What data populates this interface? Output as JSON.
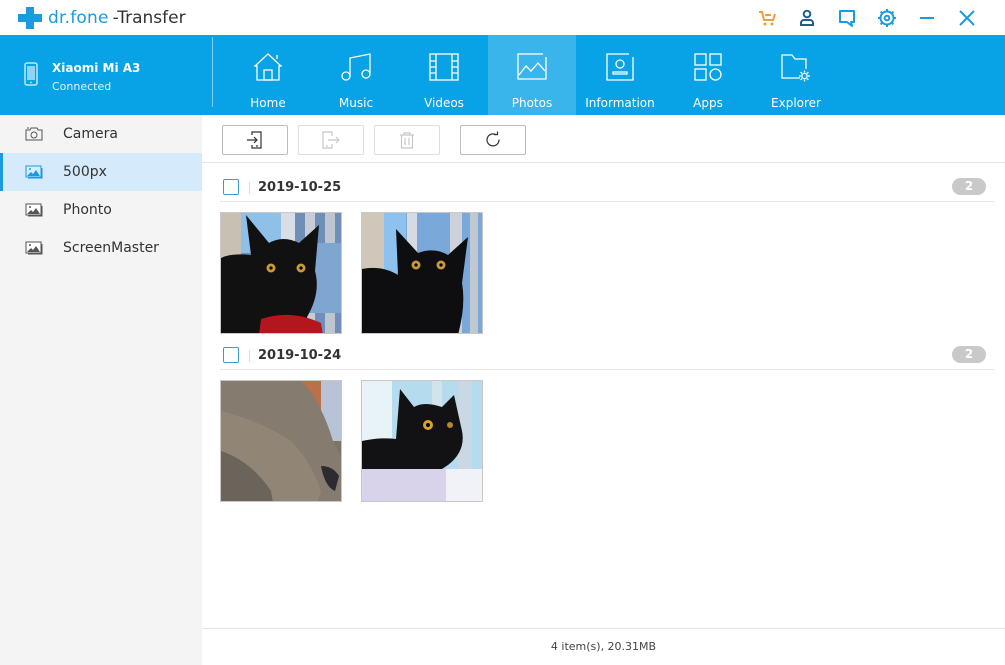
{
  "app": {
    "brand": "dr.fone",
    "product": "-Transfer"
  },
  "window_controls": [
    {
      "name": "cart-icon",
      "color": "#f0a030"
    },
    {
      "name": "user-icon",
      "color": "#1d5f8a"
    },
    {
      "name": "feedback-icon",
      "color": "#1a9be0"
    },
    {
      "name": "settings-icon",
      "color": "#1a9be0"
    },
    {
      "name": "minimize-icon",
      "color": "#1a9be0"
    },
    {
      "name": "close-icon",
      "color": "#1a9be0"
    }
  ],
  "device": {
    "name": "Xiaomi Mi A3",
    "status": "Connected"
  },
  "nav": {
    "active": "Photos",
    "items": [
      {
        "label": "Home",
        "icon": "home-icon"
      },
      {
        "label": "Music",
        "icon": "music-icon"
      },
      {
        "label": "Videos",
        "icon": "videos-icon"
      },
      {
        "label": "Photos",
        "icon": "photos-icon"
      },
      {
        "label": "Information",
        "icon": "information-icon"
      },
      {
        "label": "Apps",
        "icon": "apps-icon"
      },
      {
        "label": "Explorer",
        "icon": "explorer-icon"
      }
    ]
  },
  "sidebar": {
    "active": "500px",
    "items": [
      {
        "label": "Camera",
        "icon": "camera-icon"
      },
      {
        "label": "500px",
        "icon": "album-icon"
      },
      {
        "label": "Phonto",
        "icon": "album-icon"
      },
      {
        "label": "ScreenMaster",
        "icon": "album-icon"
      }
    ]
  },
  "toolbar": {
    "buttons": [
      {
        "name": "import-button",
        "icon": "import-icon",
        "enabled": true
      },
      {
        "name": "export-button",
        "icon": "export-icon",
        "enabled": false
      },
      {
        "name": "delete-button",
        "icon": "trash-icon",
        "enabled": false
      },
      {
        "name": "refresh-button",
        "icon": "refresh-icon",
        "enabled": true
      }
    ]
  },
  "groups": [
    {
      "date": "2019-10-25",
      "count": "2",
      "photos": [
        {
          "desc": "black cat by window, red cloth"
        },
        {
          "desc": "black cat by window"
        }
      ]
    },
    {
      "date": "2019-10-24",
      "count": "2",
      "photos": [
        {
          "desc": "gray cat fur close-up"
        },
        {
          "desc": "black cat looking up"
        }
      ]
    }
  ],
  "status": {
    "summary": "4 item(s), 20.31MB"
  }
}
